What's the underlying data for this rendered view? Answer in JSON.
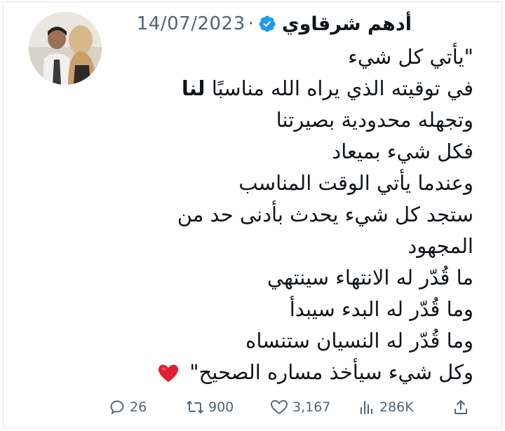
{
  "tweet": {
    "author_name": "أدهم شرقاوي",
    "date": "14/07/2023",
    "separator": "·",
    "verified_icon": "verified-badge-icon",
    "lines": [
      "\"يأتي كل شيء",
      "في توقيته الذي يراه الله مناسبًا",
      "وتجهله محدودية بصيرتنا",
      "فكل شيء بميعاد",
      "وعندما يأتي الوقت المناسب",
      "ستجد كل شيء يحدث بأدنى حد من",
      "المجهود",
      "ما قُدّر له الانتهاء سينتهي",
      "وما قُدّر له البدء سيبدأ",
      "وما قُدّر له النسيان ستنساه",
      "وكل شيء سيأخذ مساره الصحيح\""
    ],
    "bold_word": "لنا",
    "actions": {
      "replies": "26",
      "retweets": "900",
      "likes": "3,167",
      "views": "286K"
    }
  },
  "colors": {
    "text": "#0f1419",
    "muted": "#536471",
    "verified": "#1d9bf0",
    "heart": "#e0202e"
  }
}
